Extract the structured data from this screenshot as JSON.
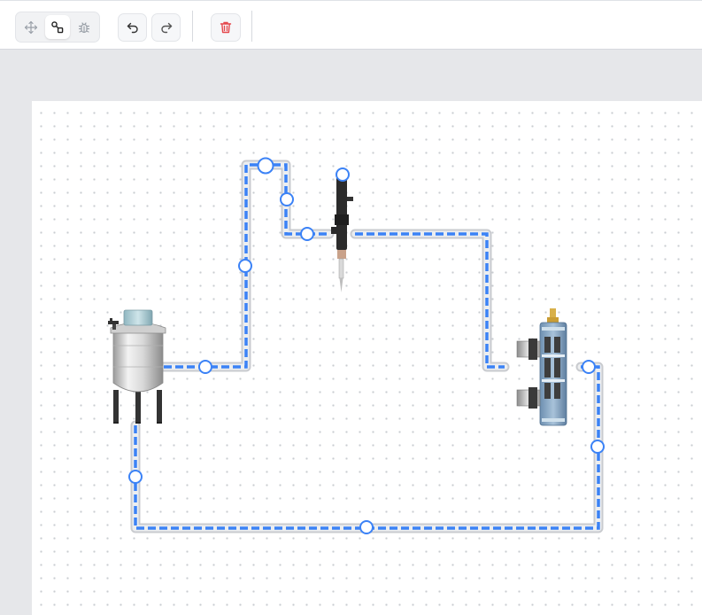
{
  "toolbar": {
    "modes": [
      {
        "name": "move",
        "icon": "move-icon",
        "active": false
      },
      {
        "name": "connect",
        "icon": "connect-icon",
        "active": true
      },
      {
        "name": "debug",
        "icon": "bug-icon",
        "active": false
      }
    ],
    "history": [
      {
        "name": "undo",
        "icon": "undo-icon"
      },
      {
        "name": "redo",
        "icon": "redo-icon"
      }
    ],
    "delete": {
      "icon": "trash-icon",
      "color": "#e5484d"
    }
  },
  "diagram": {
    "nodes": [
      {
        "name": "mixing-tank",
        "type": "tank"
      },
      {
        "name": "ultrasonic-probe",
        "type": "probe"
      },
      {
        "name": "heat-exchanger",
        "type": "exchanger"
      }
    ],
    "pipes": [
      {
        "from": "mixing-tank",
        "to": "ultrasonic-probe"
      },
      {
        "from": "ultrasonic-probe",
        "to": "heat-exchanger"
      },
      {
        "from": "heat-exchanger",
        "to": "mixing-tank"
      }
    ]
  },
  "colors": {
    "accent": "#3b82f6",
    "pipe_outline": "#c9cbcf",
    "canvas_dot": "#c9ccd1"
  }
}
